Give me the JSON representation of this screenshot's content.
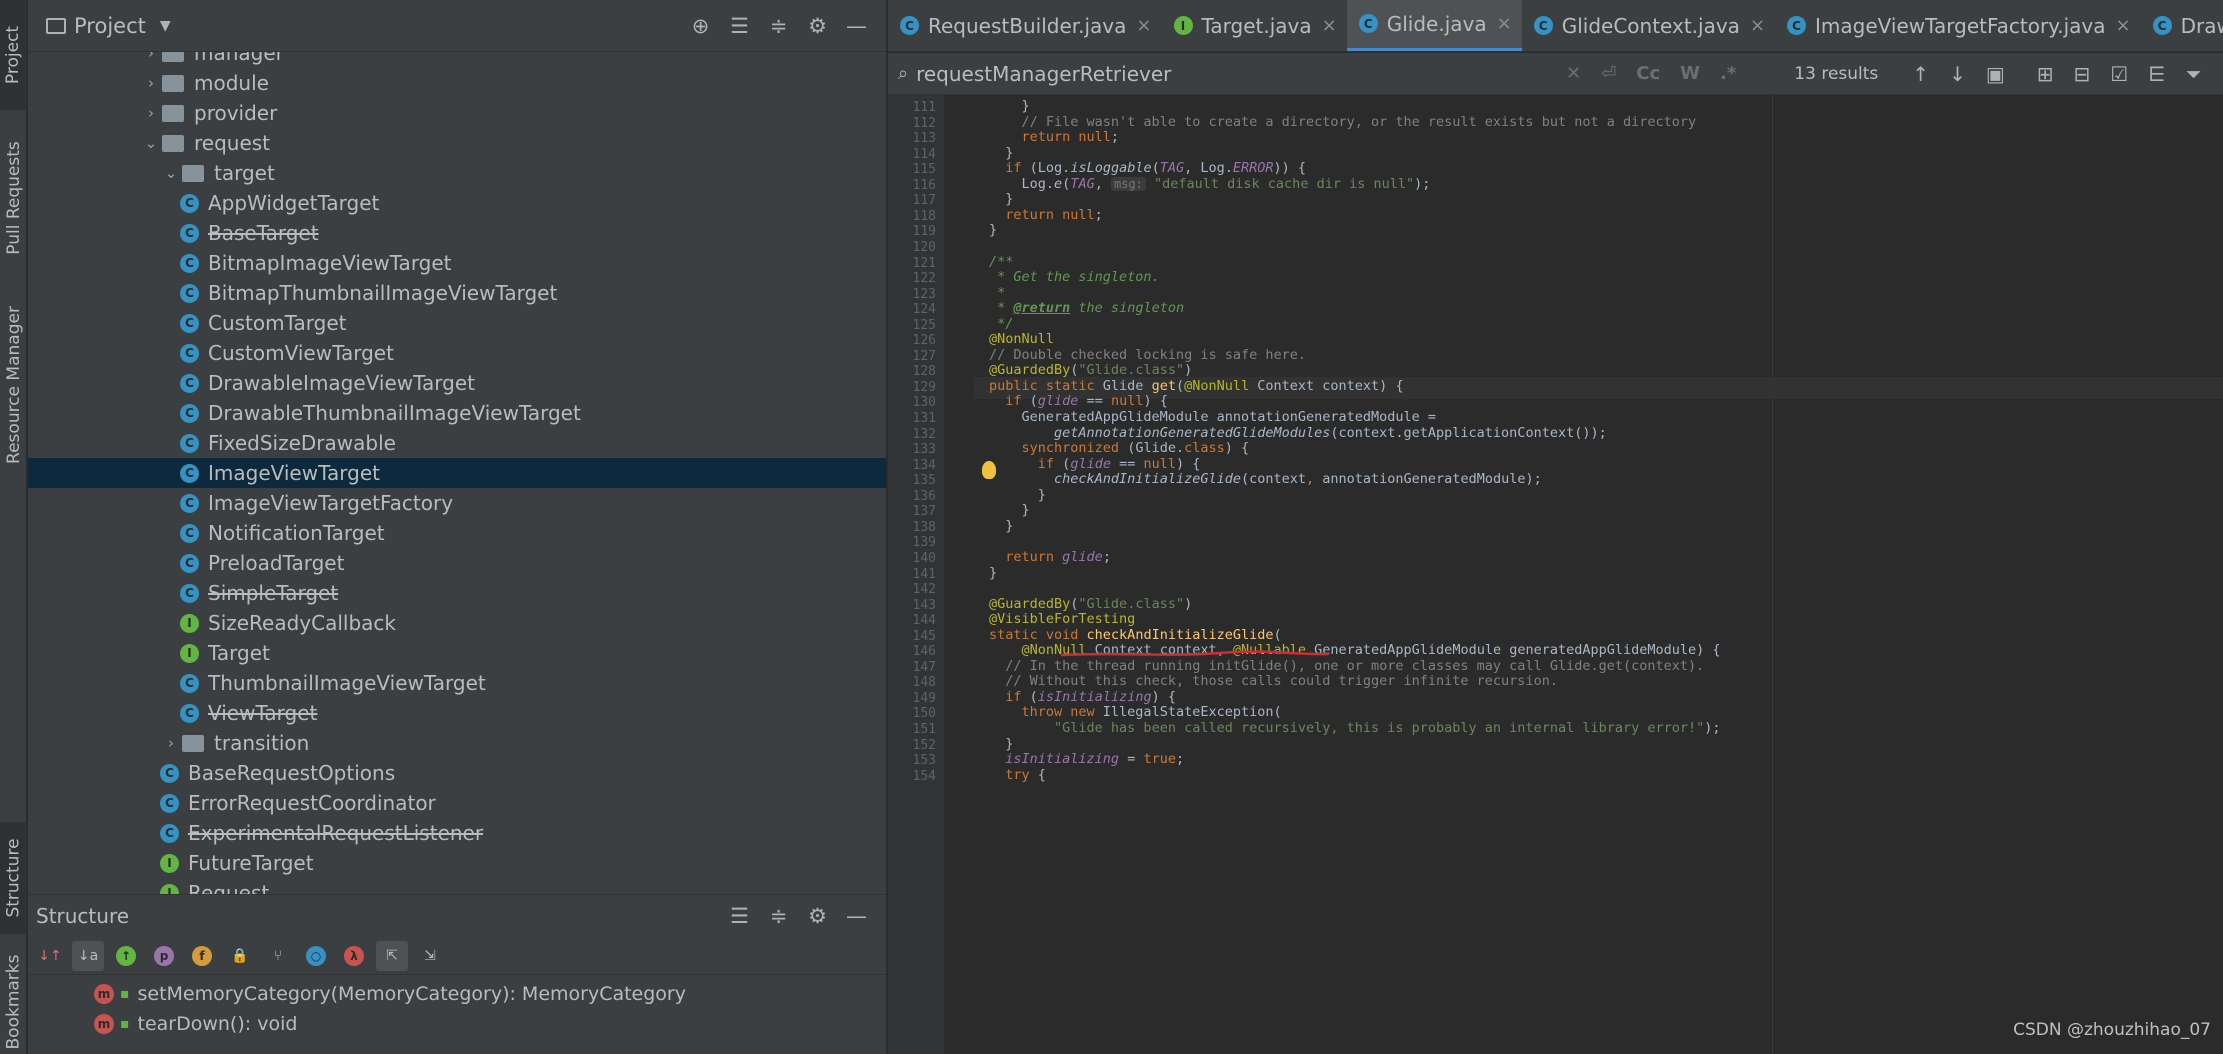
{
  "left_strip": {
    "project": "Project",
    "pull_requests": "Pull Requests",
    "resource_manager": "Resource Manager",
    "structure": "Structure",
    "bookmarks": "Bookmarks"
  },
  "project_panel": {
    "title": "Project"
  },
  "tree": [
    {
      "label": "manager",
      "type": "dir",
      "indent": 1,
      "arrow": "›"
    },
    {
      "label": "module",
      "type": "dir",
      "indent": 1,
      "arrow": "›"
    },
    {
      "label": "provider",
      "type": "dir",
      "indent": 1,
      "arrow": "›"
    },
    {
      "label": "request",
      "type": "dir",
      "indent": 1,
      "arrow": "⌄"
    },
    {
      "label": "target",
      "type": "dir",
      "indent": 2,
      "arrow": "⌄"
    },
    {
      "label": "AppWidgetTarget",
      "type": "class",
      "indent": 3
    },
    {
      "label": "BaseTarget",
      "type": "class",
      "indent": 3,
      "strike": true
    },
    {
      "label": "BitmapImageViewTarget",
      "type": "class",
      "indent": 3
    },
    {
      "label": "BitmapThumbnailImageViewTarget",
      "type": "class",
      "indent": 3
    },
    {
      "label": "CustomTarget",
      "type": "class",
      "indent": 3
    },
    {
      "label": "CustomViewTarget",
      "type": "class",
      "indent": 3
    },
    {
      "label": "DrawableImageViewTarget",
      "type": "class",
      "indent": 3
    },
    {
      "label": "DrawableThumbnailImageViewTarget",
      "type": "class",
      "indent": 3
    },
    {
      "label": "FixedSizeDrawable",
      "type": "class",
      "indent": 3
    },
    {
      "label": "ImageViewTarget",
      "type": "class",
      "indent": 3,
      "selected": true
    },
    {
      "label": "ImageViewTargetFactory",
      "type": "class",
      "indent": 3
    },
    {
      "label": "NotificationTarget",
      "type": "class",
      "indent": 3
    },
    {
      "label": "PreloadTarget",
      "type": "class",
      "indent": 3
    },
    {
      "label": "SimpleTarget",
      "type": "class",
      "indent": 3,
      "strike": true
    },
    {
      "label": "SizeReadyCallback",
      "type": "interface",
      "indent": 3
    },
    {
      "label": "Target",
      "type": "interface",
      "indent": 3
    },
    {
      "label": "ThumbnailImageViewTarget",
      "type": "class",
      "indent": 3
    },
    {
      "label": "ViewTarget",
      "type": "class",
      "indent": 3,
      "strike": true
    },
    {
      "label": "transition",
      "type": "dir",
      "indent": 2,
      "arrow": "›"
    },
    {
      "label": "BaseRequestOptions",
      "type": "class",
      "indent": 2
    },
    {
      "label": "ErrorRequestCoordinator",
      "type": "class",
      "indent": 2
    },
    {
      "label": "ExperimentalRequestListener",
      "type": "class",
      "indent": 2,
      "strike": true
    },
    {
      "label": "FutureTarget",
      "type": "interface",
      "indent": 2
    },
    {
      "label": "Request",
      "type": "interface",
      "indent": 2
    }
  ],
  "structure_panel": {
    "title": "Structure",
    "items": [
      "setMemoryCategory(MemoryCategory): MemoryCategory",
      "tearDown(): void"
    ]
  },
  "tabs": [
    {
      "label": "RequestBuilder.java",
      "icon": "C"
    },
    {
      "label": "Target.java",
      "icon": "I"
    },
    {
      "label": "Glide.java",
      "icon": "C",
      "active": true
    },
    {
      "label": "GlideContext.java",
      "icon": "C"
    },
    {
      "label": "ImageViewTargetFactory.java",
      "icon": "C"
    },
    {
      "label": "DrawableImageVie",
      "icon": "C"
    }
  ],
  "search": {
    "query": "requestManagerRetriever",
    "results": "13 results",
    "opt_cc": "Cc",
    "opt_w": "W",
    "opt_regex": ".*"
  },
  "code_lines": [
    {
      "n": "111",
      "h": "    }"
    },
    {
      "n": "112",
      "h": "    <span class='cm'>// File wasn't able to create a directory, or the result exists but not a directory</span>"
    },
    {
      "n": "113",
      "h": "    <span class='kw'>return null</span>;"
    },
    {
      "n": "114",
      "h": "  }"
    },
    {
      "n": "115",
      "h": "  <span class='kw'>if</span> (Log.<span class='it'>isLoggable</span>(<span class='fi'>TAG</span>, Log.<span class='fi'>ERROR</span>)) {"
    },
    {
      "n": "116",
      "h": "    Log.<span class='it'>e</span>(<span class='fi'>TAG</span>, <span class='hint'>msg:</span> <span class='st'>\"default disk cache dir is null\"</span>);"
    },
    {
      "n": "117",
      "h": "  }"
    },
    {
      "n": "118",
      "h": "  <span class='kw'>return null</span>;"
    },
    {
      "n": "119",
      "h": "}"
    },
    {
      "n": "120",
      "h": ""
    },
    {
      "n": "121",
      "h": "<span class='doc'>/**</span>"
    },
    {
      "n": "122",
      "h": "<span class='doc'> * Get the singleton.</span>"
    },
    {
      "n": "123",
      "h": "<span class='doc'> *</span>"
    },
    {
      "n": "124",
      "h": "<span class='doc'> * <b><u>@return</u></b> the singleton</span>"
    },
    {
      "n": "125",
      "h": "<span class='doc'> */</span>"
    },
    {
      "n": "126",
      "h": "<span class='an'>@NonNull</span>"
    },
    {
      "n": "127",
      "h": "<span class='cm'>// Double checked locking is safe here.</span>"
    },
    {
      "n": "128",
      "h": "<span class='an'>@GuardedBy</span>(<span class='st'>\"Glide.class\"</span>)"
    },
    {
      "n": "129",
      "h": "<span class='kw'>public static </span>Glide <span class='fn'>get</span>(<span class='an'>@NonNull</span> Context context) {"
    },
    {
      "n": "130",
      "h": "  <span class='kw'>if</span> (<span class='fi'>glide</span> == <span class='kw'>null</span>) {"
    },
    {
      "n": "131",
      "h": "    GeneratedAppGlideModule annotationGeneratedModule ="
    },
    {
      "n": "132",
      "h": "        <span class='it'>getAnnotationGeneratedGlideModules</span>(context.getApplicationContext());"
    },
    {
      "n": "133",
      "h": "    <span class='kw'>synchronized</span> (Glide.<span class='kw'>class</span>) {"
    },
    {
      "n": "134",
      "h": "      <span class='kw'>if</span> (<span class='fi'>glide</span> == <span class='kw'>null</span>) {"
    },
    {
      "n": "135",
      "h": "        <span class='it'>checkAndInitializeGlide</span>(context<span class='kw'>,</span> annotationGeneratedModule);"
    },
    {
      "n": "136",
      "h": "      }"
    },
    {
      "n": "137",
      "h": "    }"
    },
    {
      "n": "138",
      "h": "  }"
    },
    {
      "n": "139",
      "h": ""
    },
    {
      "n": "140",
      "h": "  <span class='kw'>return </span><span class='fi'>glide</span>;"
    },
    {
      "n": "141",
      "h": "}"
    },
    {
      "n": "142",
      "h": ""
    },
    {
      "n": "143",
      "h": "<span class='an'>@GuardedBy</span>(<span class='st'>\"Glide.class\"</span>)"
    },
    {
      "n": "144",
      "h": "<span class='an'>@VisibleForTesting</span>"
    },
    {
      "n": "145",
      "h": "<span class='kw'>static void </span><span class='fn'>checkAndInitializeGlide</span>("
    },
    {
      "n": "146",
      "h": "    <span class='an'>@NonNull</span> Context context, <span class='an'>@Nullable</span> GeneratedAppGlideModule generatedAppGlideModule) {"
    },
    {
      "n": "147",
      "h": "  <span class='cm'>// In the thread running initGlide(), one or more classes may call Glide.get(context).</span>"
    },
    {
      "n": "148",
      "h": "  <span class='cm'>// Without this check, those calls could trigger infinite recursion.</span>"
    },
    {
      "n": "149",
      "h": "  <span class='kw'>if</span> (<span class='fi'>isInitializing</span>) {"
    },
    {
      "n": "150",
      "h": "    <span class='kw'>throw new </span>IllegalStateException("
    },
    {
      "n": "151",
      "h": "        <span class='st'>\"Glide has been called recursively, this is probably an internal library error!\"</span>);"
    },
    {
      "n": "152",
      "h": "  }"
    },
    {
      "n": "153",
      "h": "  <span class='fi'>isInitializing</span> = <span class='kw'>true</span>;"
    },
    {
      "n": "154",
      "h": "  <span class='kw'>try</span> {"
    }
  ],
  "current_line": "129",
  "watermark": "CSDN @zhouzhihao_07"
}
